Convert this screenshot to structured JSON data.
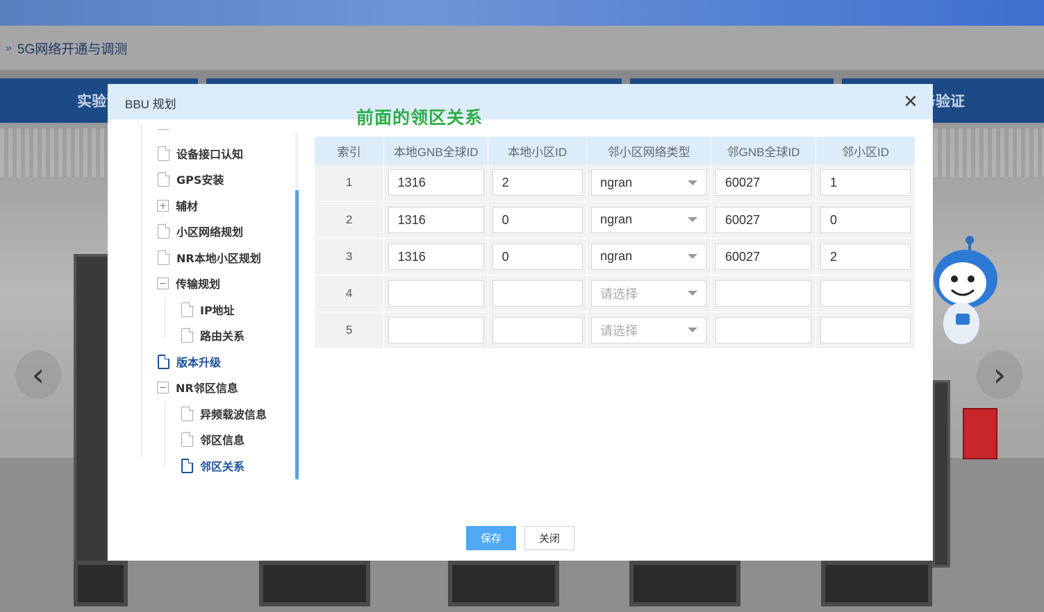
{
  "app": {
    "breadcrumb": "5G网络开通与调测",
    "tabs": [
      "实验背",
      "务验证"
    ]
  },
  "dialog": {
    "title": "BBU 规划",
    "annotation": "前面的领区关系",
    "close_icon": "close-icon"
  },
  "tree": {
    "items": [
      {
        "label": "设备接口认知",
        "icon": "document-icon"
      },
      {
        "label": "GPS安装",
        "icon": "document-icon"
      },
      {
        "label": "辅材",
        "icon": "expand-plus-icon"
      },
      {
        "label": "小区网络规划",
        "icon": "document-icon"
      },
      {
        "label": "NR本地小区规划",
        "icon": "document-icon"
      },
      {
        "label": "传输规划",
        "icon": "collapse-minus-icon"
      },
      {
        "label": "IP地址",
        "icon": "document-icon"
      },
      {
        "label": "路由关系",
        "icon": "document-icon"
      },
      {
        "label": "版本升级",
        "icon": "document-icon"
      },
      {
        "label": "NR邻区信息",
        "icon": "collapse-minus-icon"
      },
      {
        "label": "异频载波信息",
        "icon": "document-icon"
      },
      {
        "label": "邻区信息",
        "icon": "document-icon"
      },
      {
        "label": "邻区关系",
        "icon": "document-icon"
      }
    ],
    "active": "邻区关系"
  },
  "table": {
    "headers": [
      "索引",
      "本地GNB全球ID",
      "本地小区ID",
      "邻小区网络类型",
      "邻GNB全球ID",
      "邻小区ID"
    ],
    "select_placeholder": "请选择",
    "rows": [
      {
        "index": "1",
        "local_gnb": "1316",
        "local_cell": "2",
        "net_type": "ngran",
        "nbr_gnb": "60027",
        "nbr_cell": "1"
      },
      {
        "index": "2",
        "local_gnb": "1316",
        "local_cell": "0",
        "net_type": "ngran",
        "nbr_gnb": "60027",
        "nbr_cell": "0"
      },
      {
        "index": "3",
        "local_gnb": "1316",
        "local_cell": "0",
        "net_type": "ngran",
        "nbr_gnb": "60027",
        "nbr_cell": "2"
      },
      {
        "index": "4",
        "local_gnb": "",
        "local_cell": "",
        "net_type": "",
        "nbr_gnb": "",
        "nbr_cell": ""
      },
      {
        "index": "5",
        "local_gnb": "",
        "local_cell": "",
        "net_type": "",
        "nbr_gnb": "",
        "nbr_cell": ""
      }
    ]
  },
  "buttons": {
    "save": "保存",
    "close": "关闭"
  },
  "colors": {
    "header_bg": "#dcecfa",
    "primary": "#4fa8f3",
    "annotation": "#2cae45",
    "active_tree": "#1c4f9c"
  }
}
